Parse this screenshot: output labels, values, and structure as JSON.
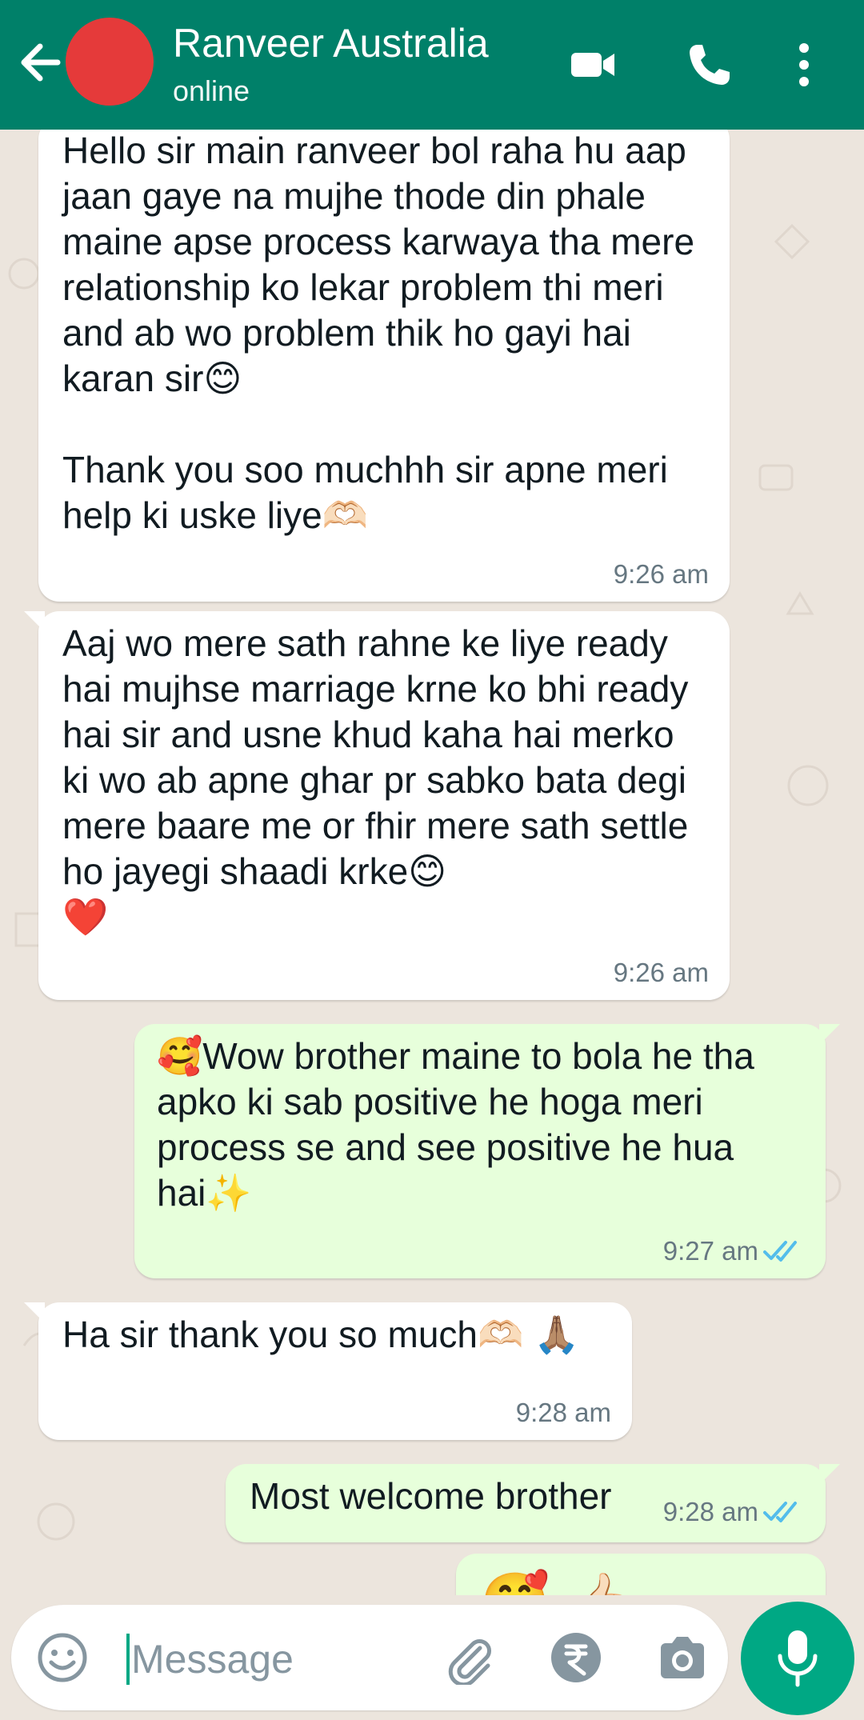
{
  "header": {
    "title": "Ranveer Australia",
    "status": "online",
    "icons": [
      "back-arrow-icon",
      "video-call-icon",
      "voice-call-icon",
      "more-options-icon"
    ],
    "color": "#008069"
  },
  "messages": [
    {
      "direction": "incoming",
      "text": "Hello sir main ranveer bol raha hu aap jaan gaye na mujhe thode din phale maine apse process karwaya tha mere relationship ko lekar problem thi meri and ab wo problem thik ho gayi hai karan sir😊\n\nThank you soo muchhh sir apne meri help ki uske liye🫶🏻",
      "time": "9:26 am"
    },
    {
      "direction": "incoming",
      "text": "Aaj wo mere sath rahne ke liye ready hai mujhse marriage krne ko bhi ready hai sir and usne khud kaha hai merko ki wo ab apne ghar pr sabko bata degi mere baare me or fhir mere sath settle ho jayegi shaadi krke😊\n❤️",
      "time": "9:26 am"
    },
    {
      "direction": "outgoing",
      "text": "🥰Wow brother maine to bola he tha apko ki sab positive he hoga meri process se and see positive he hua hai✨",
      "time": "9:27 am",
      "read": true
    },
    {
      "direction": "incoming",
      "text": "Ha sir thank you so much🫶🏻 🙏🏽",
      "time": "9:28 am"
    },
    {
      "direction": "outgoing",
      "text": "Most welcome brother",
      "time": "9:28 am",
      "read": true
    },
    {
      "direction": "outgoing",
      "text": "🥰 👍🏻",
      "partial": true
    }
  ],
  "composer": {
    "placeholder": "Message",
    "icons": [
      "emoji-icon",
      "attach-icon",
      "rupee-payment-icon",
      "camera-icon",
      "mic-icon"
    ],
    "accent": "#00a884"
  },
  "colors": {
    "chat_background": "#ece5dd",
    "incoming_bubble": "#ffffff",
    "outgoing_bubble": "#e7ffdb",
    "read_ticks": "#53bdeb",
    "timestamp": "#667781"
  }
}
